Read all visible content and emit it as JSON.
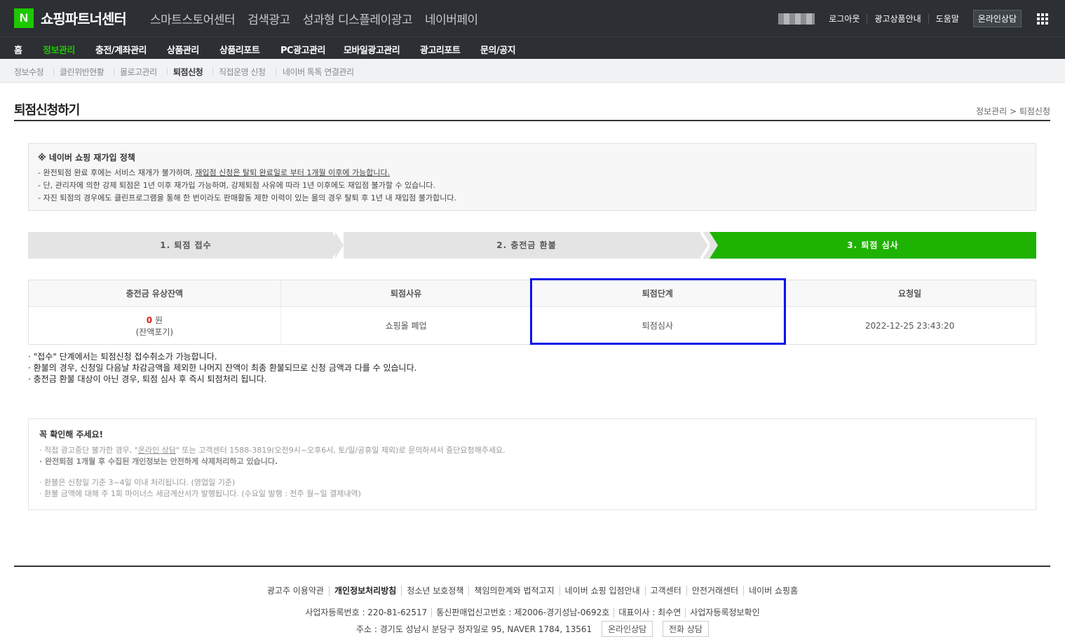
{
  "brand": {
    "logo_letter": "N",
    "title": "쇼핑파트너센터"
  },
  "services": [
    "스마트스토어센터",
    "검색광고",
    "성과형 디스플레이광고",
    "네이버페이"
  ],
  "top_links": {
    "logout": "로그아웃",
    "ad_info": "광고상품안내",
    "help": "도움말",
    "consult": "온라인상담"
  },
  "menu": [
    "홈",
    "정보관리",
    "충전/계좌관리",
    "상품관리",
    "상품리포트",
    "PC광고관리",
    "모바일광고관리",
    "광고리포트",
    "문의/공지"
  ],
  "submenu": [
    "정보수정",
    "클린위반현황",
    "몰로고관리",
    "퇴점신청",
    "직접운영 신청",
    "네이버 톡톡 연결관리"
  ],
  "page": {
    "title": "퇴점신청하기",
    "breadcrumb": "정보관리 > 퇴점신청"
  },
  "policy": {
    "heading": "※ 네이버 쇼핑 재가입 정책",
    "line1_prefix": "- 완전퇴점 완료 후에는 서비스 재개가 불가하며, ",
    "line1_underline": "재입점 신청은 탈퇴 완료일로 부터 1개월 이후에 가능합니다.",
    "line2": "- 단, 관리자에 의한 강제 퇴점은 1년 이후 재가입 가능하며, 강제퇴점 사유에 따라 1년 이후에도 재입점 불가할 수 있습니다.",
    "line3": "- 자진 퇴점의 경우에도 클린프로그램을 통해 한 번이라도 판매활동 제한 이력이 있는 몰의 경우 탈퇴 후 1년 내 재입점 불가합니다."
  },
  "steps": [
    "1. 퇴점 접수",
    "2. 충전금 환불",
    "3. 퇴점 심사"
  ],
  "table": {
    "headers": [
      "충전금 유상잔액",
      "퇴점사유",
      "퇴점단계",
      "요청일"
    ],
    "balance_amount": "0",
    "balance_unit": "원",
    "balance_note": "(잔액포기)",
    "reason": "쇼핑몰 폐업",
    "stage": "퇴점심사",
    "date": "2022-12-25 23:43:20"
  },
  "notes": [
    "· \"접수\" 단계에서는 퇴점신청 접수취소가 가능합니다.",
    "· 환불의 경우, 신청일 다음날 차감금액을 제외한 나머지 잔액이 최종 환불되므로 신청 금액과 다를 수 있습니다.",
    "· 충전금 환불 대상이 아닌 경우, 퇴점 심사 후 즉시 퇴점처리 됩니다."
  ],
  "check": {
    "heading": "꼭 확인해 주세요!",
    "line1_a": "· 직접 광고중단 불가한 경우, \"",
    "line1_link": "온라인 상담",
    "line1_b": "\" 또는 고객센터 1588-3819(오전9시~오후6시, 토/일/공휴일 제외)로 문의하셔서 중단요청해주세요.",
    "line2": "· 완전퇴점 1개월 후 수집된 개인정보는 안전하게 삭제처리하고 있습니다.",
    "line3": "· 환불은 신청일 기준 3~4일 이내 처리됩니다. (영업일 기준)",
    "line4": "· 환불 금액에 대해 주 1회 마이너스 세금계산서가 발행됩니다. (수요일 발행 : 전주 월~일 결제내역)"
  },
  "footer": {
    "links": [
      "광고주 이용약관",
      "개인정보처리방침",
      "청소년 보호정책",
      "책임의한계와 법적고지",
      "네이버 쇼핑 입점안내",
      "고객센터",
      "안전거래센터",
      "네이버 쇼핑홈"
    ],
    "info1": [
      "사업자등록번호 : 220-81-62517",
      "통신판매업신고번호 : 제2006-경기성남-0692호",
      "대표이사 : 최수연",
      "사업자등록정보확인"
    ],
    "address": "주소 : 경기도 성남시 분당구 정자일로 95, NAVER 1784, 13561",
    "btn_online": "온라인상담",
    "btn_phone": "전화 상담"
  }
}
